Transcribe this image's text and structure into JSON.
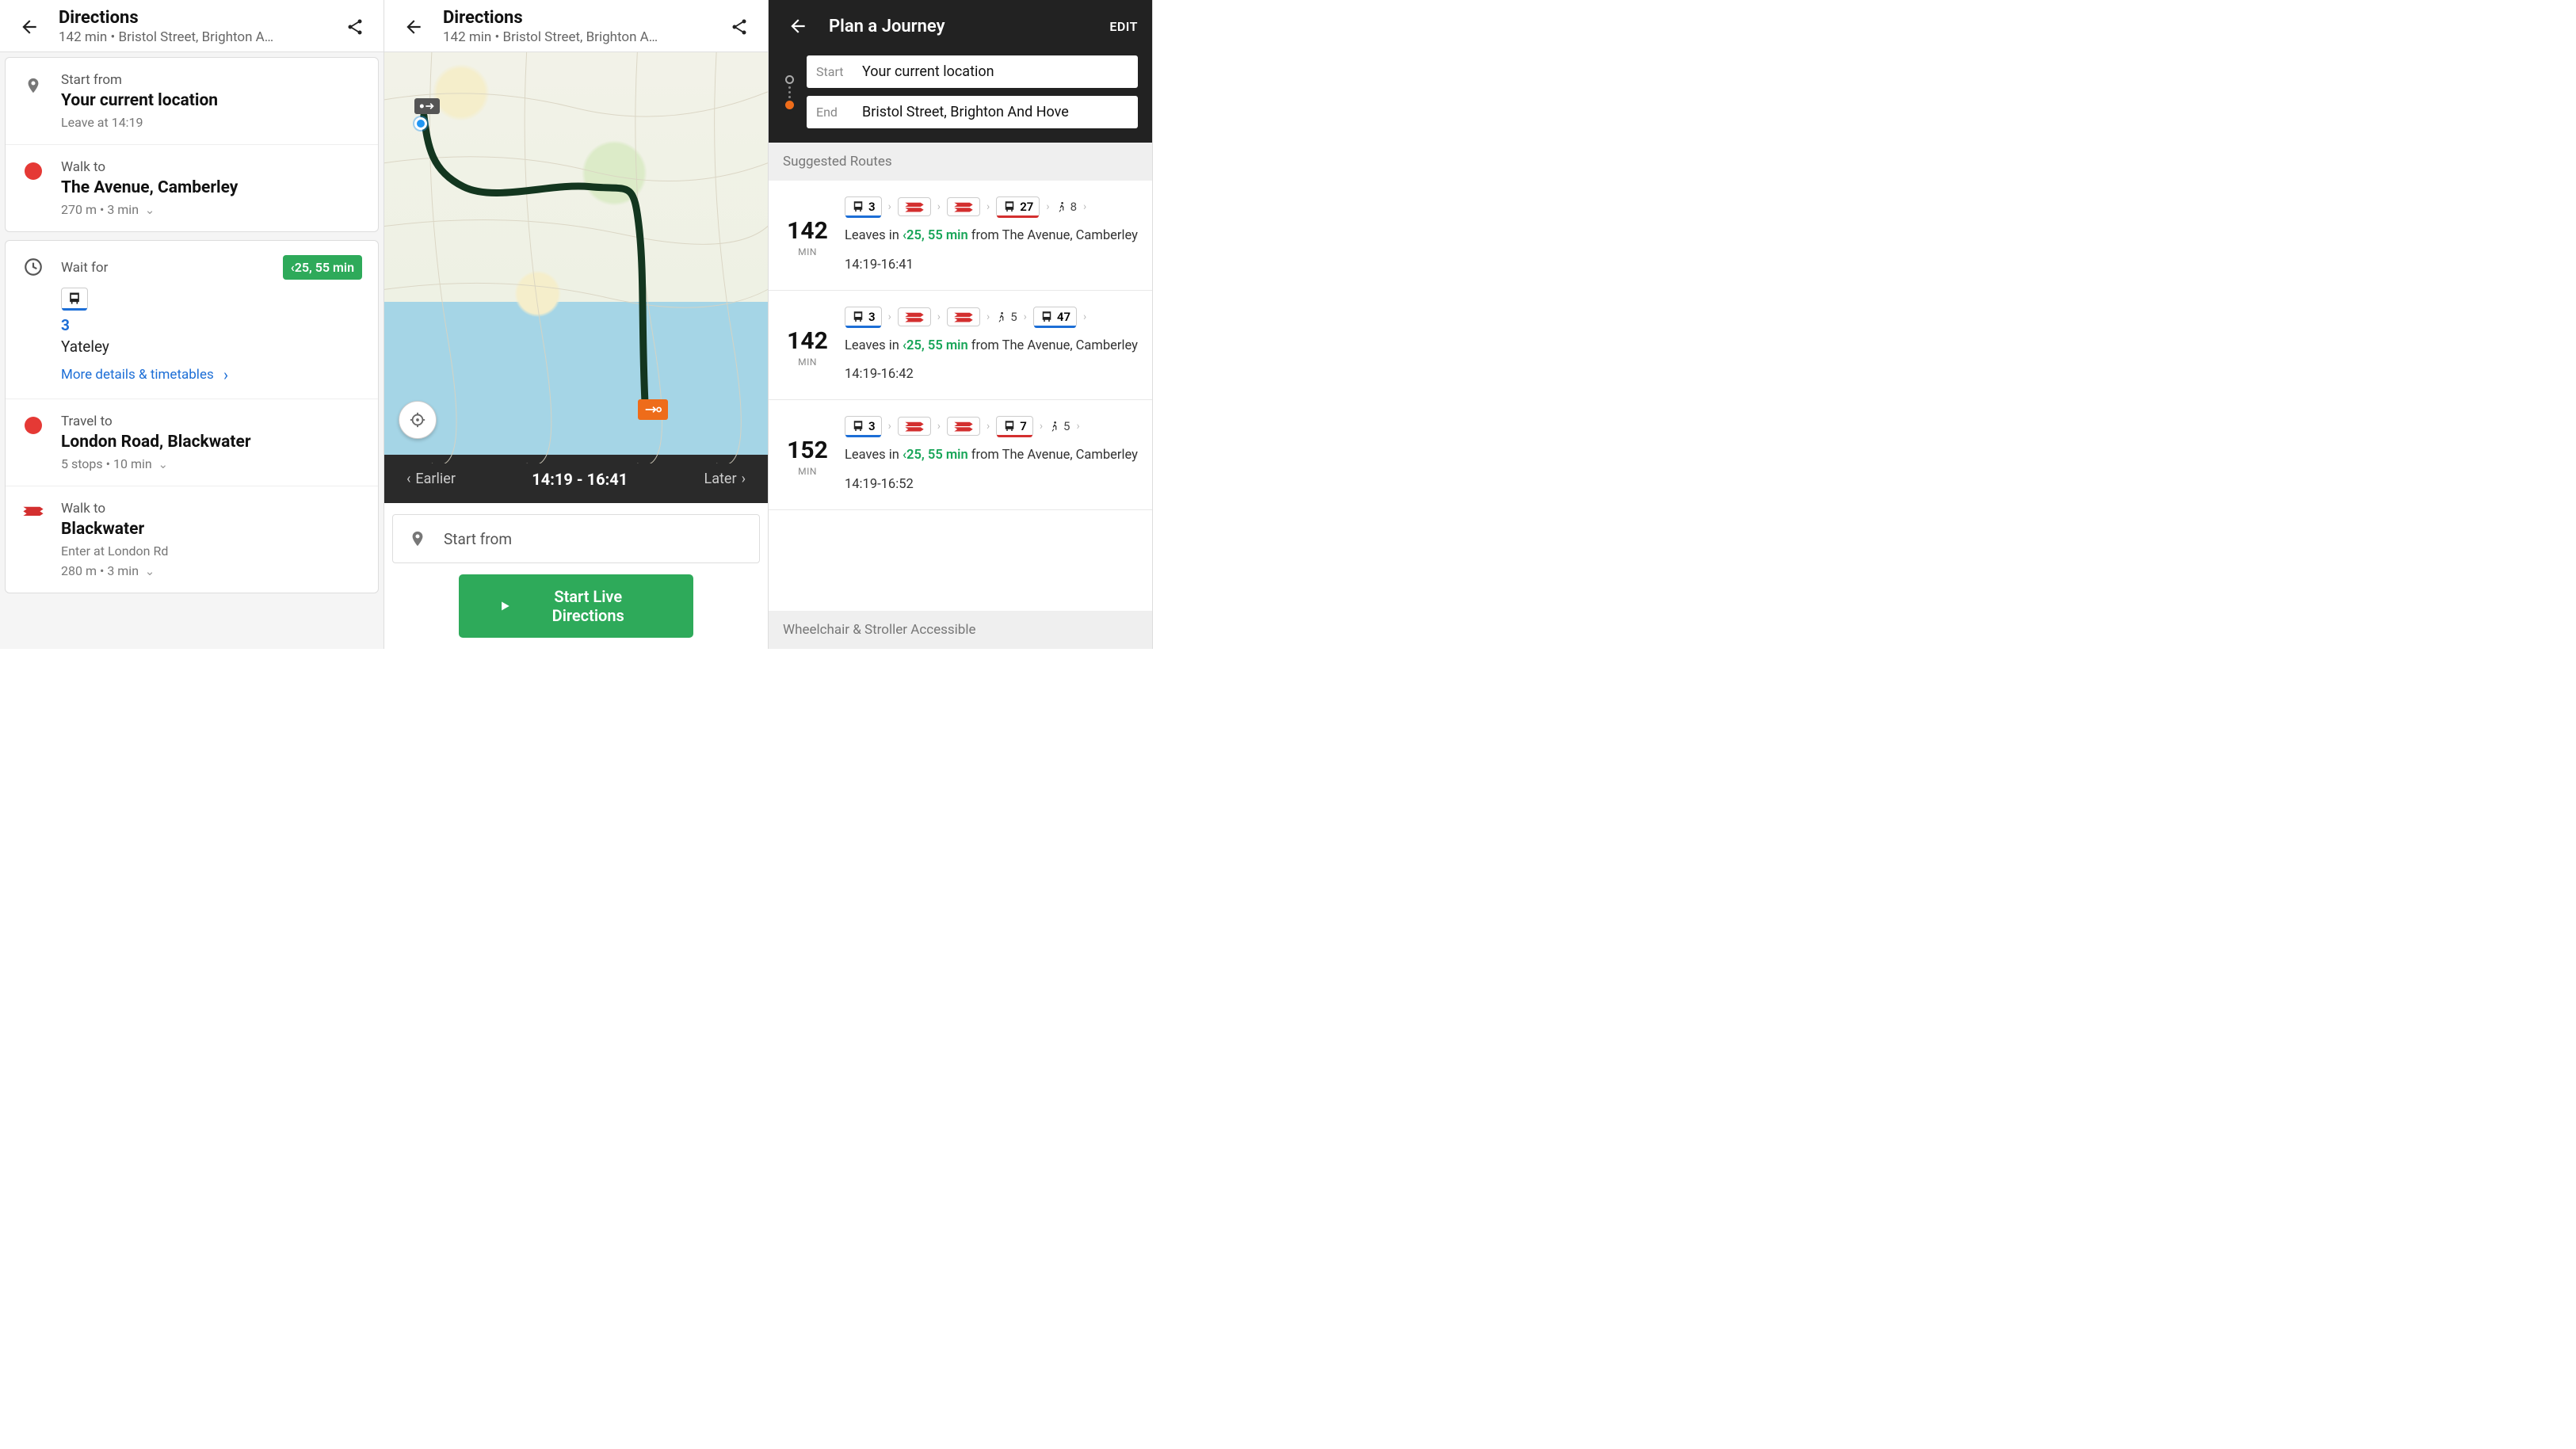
{
  "panel1": {
    "title": "Directions",
    "subtitle": "142 min • Bristol Street, Brighton A…",
    "steps": [
      {
        "label": "Start from",
        "main": "Your current location",
        "sub": "Leave at 14:19"
      },
      {
        "label": "Walk to",
        "main": "The Avenue, Camberley",
        "sub": "270 m • 3 min"
      }
    ],
    "wait": {
      "label": "Wait for",
      "badge": "‹25, 55 min",
      "routeNo": "3",
      "dest": "Yateley",
      "link": "More details & timetables"
    },
    "travel": {
      "label": "Travel to",
      "main": "London Road, Blackwater",
      "sub": "5 stops • 10 min"
    },
    "walk2": {
      "label": "Walk to",
      "main": "Blackwater",
      "sub1": "Enter at London Rd",
      "sub2": "280 m • 3 min"
    }
  },
  "panel2": {
    "title": "Directions",
    "subtitle": "142 min • Bristol Street, Brighton A…",
    "earlier": "Earlier",
    "later": "Later",
    "timerange": "14:19 - 16:41",
    "startFrom": "Start from",
    "liveBtn": "Start Live Directions"
  },
  "panel3": {
    "title": "Plan a Journey",
    "edit": "EDIT",
    "startTag": "Start",
    "startVal": "Your current location",
    "endTag": "End",
    "endVal": "Bristol Street, Brighton And Hove",
    "suggested": "Suggested Routes",
    "routes": [
      {
        "mins": "142",
        "modes": [
          {
            "t": "bus",
            "n": "3",
            "c": "blue"
          },
          {
            "t": "rail"
          },
          {
            "t": "rail"
          },
          {
            "t": "bus",
            "n": "27",
            "c": "red"
          },
          {
            "t": "walk",
            "n": "8"
          }
        ],
        "leaves": "25, 55 min",
        "from": " from The Avenue, Camberley",
        "range": "14:19-16:41"
      },
      {
        "mins": "142",
        "modes": [
          {
            "t": "bus",
            "n": "3",
            "c": "blue"
          },
          {
            "t": "rail"
          },
          {
            "t": "rail"
          },
          {
            "t": "walk",
            "n": "5"
          },
          {
            "t": "bus",
            "n": "47",
            "c": "blue"
          }
        ],
        "leaves": "25, 55 min",
        "from": " from The Avenue, Camberley",
        "range": "14:19-16:42"
      },
      {
        "mins": "152",
        "modes": [
          {
            "t": "bus",
            "n": "3",
            "c": "blue"
          },
          {
            "t": "rail"
          },
          {
            "t": "rail"
          },
          {
            "t": "bus",
            "n": "7",
            "c": "red"
          },
          {
            "t": "walk",
            "n": "5"
          }
        ],
        "leaves": "25, 55 min",
        "from": " from The Avenue, Camberley",
        "range": "14:19-16:52"
      }
    ],
    "accessible": "Wheelchair & Stroller Accessible",
    "leavesPrefix": "Leaves in ",
    "minLabel": "MIN"
  }
}
